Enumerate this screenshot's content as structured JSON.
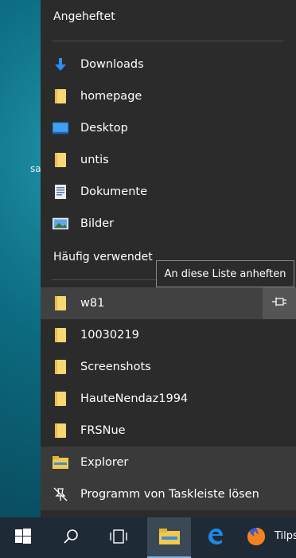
{
  "desktop": {
    "partial_text": "sa"
  },
  "jumplist": {
    "pinned_header": "Angeheftet",
    "pinned": [
      {
        "label": "Downloads",
        "icon": "downloads-icon"
      },
      {
        "label": "homepage",
        "icon": "folder-icon"
      },
      {
        "label": "Desktop",
        "icon": "desktop-icon"
      },
      {
        "label": "untis",
        "icon": "folder-icon"
      },
      {
        "label": "Dokumente",
        "icon": "documents-icon"
      },
      {
        "label": "Bilder",
        "icon": "pictures-icon"
      }
    ],
    "frequent_header": "Häufig verwendet",
    "frequent": [
      {
        "label": "w81",
        "icon": "folder-icon"
      },
      {
        "label": "10030219",
        "icon": "folder-icon"
      },
      {
        "label": "Screenshots",
        "icon": "folder-icon"
      },
      {
        "label": "HauteNendaz1994",
        "icon": "folder-icon"
      },
      {
        "label": "FRSNue",
        "icon": "folder-icon"
      }
    ],
    "tooltip": "An diese Liste anheften",
    "pin_icon": "pin-icon",
    "actions": [
      {
        "label": "Explorer",
        "icon": "file-explorer-icon"
      },
      {
        "label": "Programm von Taskleiste lösen",
        "icon": "unpin-icon"
      }
    ]
  },
  "taskbar": {
    "buttons": [
      "start-icon",
      "search-icon",
      "task-view-icon",
      "file-explorer-icon",
      "edge-icon",
      "firefox-icon"
    ],
    "firefox_label": "Tilps"
  },
  "colors": {
    "menu_bg": "#2b2b2b",
    "hover_bg": "#414141",
    "taskbar_bg": "#1f2a37",
    "folder_yellow": "#f7d774",
    "accent_blue": "#2d8cf0"
  }
}
